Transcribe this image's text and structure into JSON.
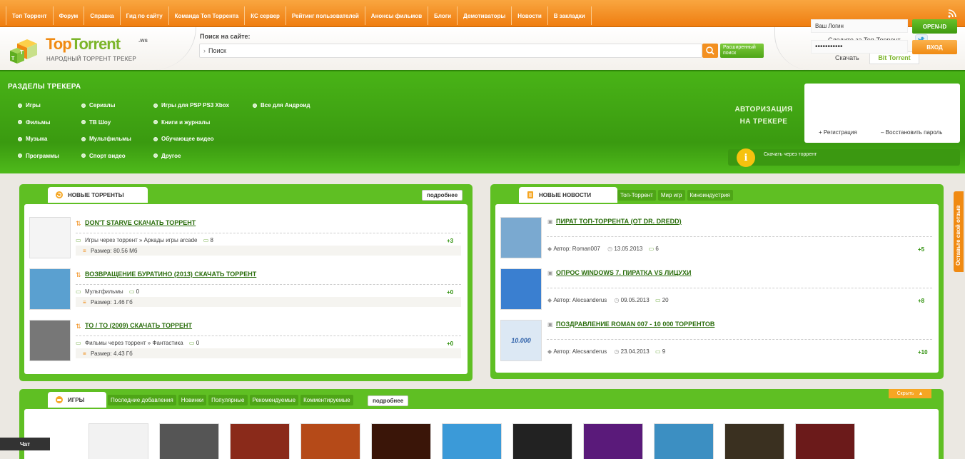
{
  "nav": {
    "items": [
      "Топ Торрент",
      "Форум",
      "Справка",
      "Гид по сайту",
      "Команда Топ Торрента",
      "КС сервер",
      "Рейтинг пользователей",
      "Анонсы фильмов",
      "Блоги",
      "Демотиваторы",
      "Новости",
      "В закладки"
    ]
  },
  "header": {
    "logo_top": "Top",
    "logo_torrent": "Torrent",
    "logo_ws": ".ws",
    "logo_sub": "НАРОДНЫЙ ТОРРЕНТ ТРЕКЕР",
    "search_label": "Поиск на сайте:",
    "search_value": "Поиск",
    "adv_search": "Расширенный поиск",
    "follow": "Следите за Топ-Торрент",
    "download": "Скачать",
    "bt_bit": "Bit",
    "bt_torrent": "Torrent"
  },
  "sections": {
    "title": "РАЗДЕЛЫ ТРЕКЕРА",
    "col1": [
      "Игры",
      "Фильмы",
      "Музыка",
      "Программы"
    ],
    "col2": [
      "Сериалы",
      "ТВ Шоу",
      "Мультфильмы",
      "Спорт видео"
    ],
    "col3": [
      "Игры для PSP PS3 Xbox",
      "Книги и журналы",
      "Обучающее видео",
      "Другое"
    ],
    "col4": [
      "Все для Андроид"
    ]
  },
  "auth": {
    "line1": "АВТОРИЗАЦИЯ",
    "line2": "НА ТРЕКЕРЕ",
    "login_value": "Ваш Логин",
    "password_value": "•••••••••••",
    "openid": "OPEN-ID",
    "enter": "ВХОД",
    "register": "Регистрация",
    "restore": "Восстановить пароль",
    "info": "Скачать через торрент"
  },
  "new_torrents": {
    "title": "НОВЫЕ ТОРРЕНТЫ",
    "more": "подробнее",
    "items": [
      {
        "title": "DON'T STARVE СКАЧАТЬ ТОРРЕНТ",
        "category": "Игры через торрент » Аркады игры arcade",
        "comments": "8",
        "rating": "+3",
        "size": "Размер: 80.56 Мб"
      },
      {
        "title": "ВОЗВРАЩЕНИЕ БУРАТИНО (2013) СКАЧАТЬ ТОРРЕНТ",
        "category": "Мультфильмы",
        "comments": "0",
        "rating": "+0",
        "size": "Размер: 1.46 Гб"
      },
      {
        "title": "ТО / TO (2009) СКАЧАТЬ ТОРРЕНТ",
        "category": "Фильмы через торрент » Фантастика",
        "comments": "0",
        "rating": "+0",
        "size": "Размер: 4.43 Гб"
      }
    ]
  },
  "news": {
    "title": "НОВЫЕ НОВОСТИ",
    "tabs": [
      "Топ-Торрент",
      "Мир игр",
      "Киноиндустрия"
    ],
    "items": [
      {
        "title": "ПИРАТ ТОП-ТОРРЕНТА (OT DR. DREDD)",
        "author": "Автор: Roman007",
        "date": "13.05.2013",
        "comments": "6",
        "rating": "+5"
      },
      {
        "title": "ОПРОС WINDOWS 7. ПИРАТКА VS ЛИЦУХИ",
        "author": "Автор: Alecsanderus",
        "date": "09.05.2013",
        "comments": "20",
        "rating": "+8"
      },
      {
        "title": "ПОЗДРАВЛЕНИЕ ROMAN 007 - 10 000 ТОРРЕНТОВ",
        "author": "Автор: Alecsanderus",
        "date": "23.04.2013",
        "comments": "9",
        "rating": "+10",
        "thumb_text": "10.000"
      }
    ]
  },
  "games": {
    "title": "ИГРЫ",
    "tabs": [
      "Последние добавления",
      "Новинки",
      "Популярные",
      "Рекомендуемые",
      "Комментируемые"
    ],
    "more": "подробнее",
    "hide": "Скрыть",
    "covers": [
      {
        "color": "#f2f2f2"
      },
      {
        "color": "#555"
      },
      {
        "color": "#8a2a1a"
      },
      {
        "color": "#b54a18"
      },
      {
        "color": "#3a1508"
      },
      {
        "color": "#3b9ad8"
      },
      {
        "color": "#222"
      },
      {
        "color": "#5a1a7a"
      },
      {
        "color": "#3c8fc2"
      },
      {
        "color": "#3a3020"
      },
      {
        "color": "#6b1a1a"
      }
    ]
  },
  "feedback": "Оставьте свой отзыв",
  "chat": "Чат",
  "colors": {
    "green": "#4fba1b",
    "orange": "#f08a12",
    "link": "#2b6e0d"
  }
}
